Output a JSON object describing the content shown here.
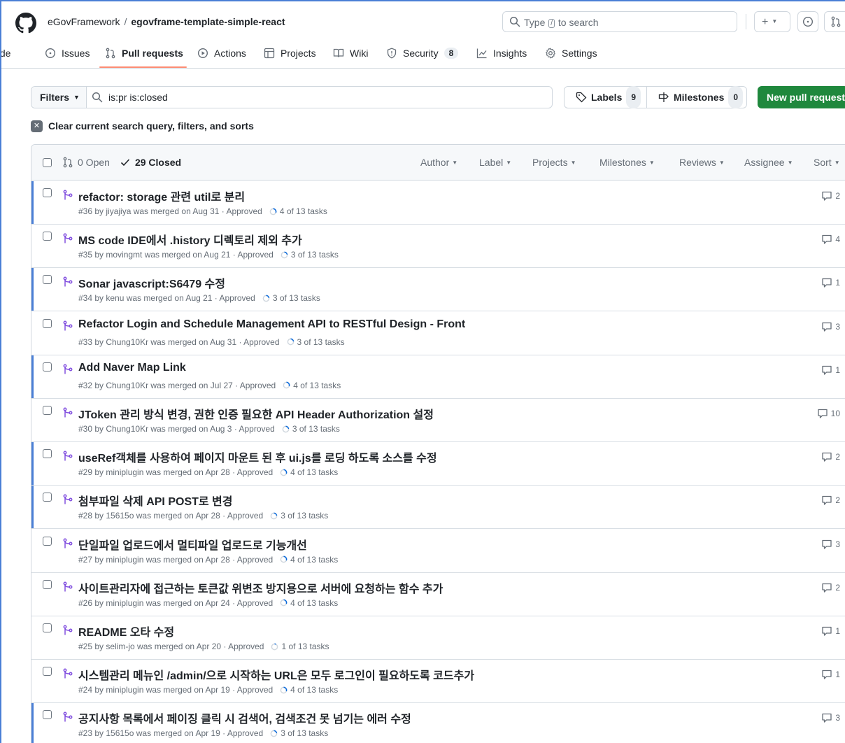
{
  "header": {
    "owner": "eGovFramework",
    "separator": "/",
    "repo": "egovframe-template-simple-react",
    "search_pre": "Type",
    "search_key": "/",
    "search_post": "to search",
    "command_glyph": ">_",
    "plus_glyph": "+"
  },
  "nav": {
    "items": [
      {
        "label": "Code",
        "icon": "code-icon"
      },
      {
        "label": "Issues",
        "icon": "issue-opened-icon"
      },
      {
        "label": "Pull requests",
        "icon": "git-pull-request-icon"
      },
      {
        "label": "Actions",
        "icon": "play-icon"
      },
      {
        "label": "Projects",
        "icon": "table-icon"
      },
      {
        "label": "Wiki",
        "icon": "book-icon"
      },
      {
        "label": "Security",
        "icon": "shield-icon",
        "count": "8"
      },
      {
        "label": "Insights",
        "icon": "graph-icon"
      },
      {
        "label": "Settings",
        "icon": "gear-icon"
      }
    ],
    "active": "Pull requests"
  },
  "filters": {
    "button_label": "Filters",
    "query": "is:pr is:closed",
    "labels_label": "Labels",
    "labels_count": "9",
    "milestones_label": "Milestones",
    "milestones_count": "0",
    "new_pr_label": "New pull request",
    "clear_label": "Clear current search query, filters, and sorts"
  },
  "list_header": {
    "open_label": "0 Open",
    "closed_label": "29 Closed",
    "filters": [
      "Author",
      "Label",
      "Projects",
      "Milestones",
      "Reviews",
      "Assignee",
      "Sort"
    ]
  },
  "pull_requests": [
    {
      "title": "refactor: storage 관련 util로 분리",
      "meta": "#36 by jiyajiya was merged on Aug 31 · Approved",
      "tasks": "4 of 13 tasks",
      "progress": 0.31,
      "comments": "2",
      "unread": true
    },
    {
      "title": "MS code IDE에서 .history 디렉토리 제외 추가",
      "meta": "#35 by movingmt was merged on Aug 21 · Approved",
      "tasks": "3 of 13 tasks",
      "progress": 0.23,
      "comments": "4",
      "unread": false
    },
    {
      "title": "Sonar javascript:S6479 수정",
      "meta": "#34 by kenu was merged on Aug 21 · Approved",
      "tasks": "3 of 13 tasks",
      "progress": 0.23,
      "comments": "1",
      "unread": true
    },
    {
      "title": "Refactor Login and Schedule Management API to RESTful Design - Front",
      "meta": "#33 by Chung10Kr was merged on Aug 31 · Approved",
      "tasks": "3 of 13 tasks",
      "progress": 0.23,
      "comments": "3",
      "unread": false
    },
    {
      "title": "Add Naver Map Link",
      "meta": "#32 by Chung10Kr was merged on Jul 27 · Approved",
      "tasks": "4 of 13 tasks",
      "progress": 0.31,
      "comments": "1",
      "unread": true
    },
    {
      "title": "JToken 관리 방식 변경, 권한 인증 필요한 API Header Authorization 설정",
      "meta": "#30 by Chung10Kr was merged on Aug 3 · Approved",
      "tasks": "3 of 13 tasks",
      "progress": 0.23,
      "comments": "10",
      "unread": false
    },
    {
      "title": "useRef객체를 사용하여 페이지 마운트 된 후 ui.js를 로딩 하도록 소스를 수정",
      "meta": "#29 by miniplugin was merged on Apr 28 · Approved",
      "tasks": "4 of 13 tasks",
      "progress": 0.31,
      "comments": "2",
      "unread": true
    },
    {
      "title": "첨부파일 삭제 API POST로 변경",
      "meta": "#28 by 15615o was merged on Apr 28 · Approved",
      "tasks": "3 of 13 tasks",
      "progress": 0.23,
      "comments": "2",
      "unread": true
    },
    {
      "title": "단일파일 업로드에서 멀티파일 업로드로 기능개선",
      "meta": "#27 by miniplugin was merged on Apr 28 · Approved",
      "tasks": "4 of 13 tasks",
      "progress": 0.31,
      "comments": "3",
      "unread": false
    },
    {
      "title": "사이트관리자에 접근하는 토큰값 위변조 방지용으로 서버에 요청하는 함수 추가",
      "meta": "#26 by miniplugin was merged on Apr 24 · Approved",
      "tasks": "4 of 13 tasks",
      "progress": 0.31,
      "comments": "2",
      "unread": false
    },
    {
      "title": "README 오타 수정",
      "meta": "#25 by selim-jo was merged on Apr 20 · Approved",
      "tasks": "1 of 13 tasks",
      "progress": 0.08,
      "comments": "1",
      "unread": false
    },
    {
      "title": "시스템관리 메뉴인 /admin/으로 시작하는 URL은 모두 로그인이 필요하도록 코드추가",
      "meta": "#24 by miniplugin was merged on Apr 19 · Approved",
      "tasks": "4 of 13 tasks",
      "progress": 0.31,
      "comments": "1",
      "unread": false
    },
    {
      "title": "공지사항 목록에서 페이징 클릭 시 검색어, 검색조건 못 넘기는 에러 수정",
      "meta": "#23 by 15615o was merged on Apr 19 · Approved",
      "tasks": "3 of 13 tasks",
      "progress": 0.23,
      "comments": "3",
      "unread": true
    }
  ],
  "colors": {
    "merged_purple": "#8250df",
    "primary_green": "#1f883d",
    "nav_underline": "#fd8c73",
    "unread_bar": "#4a7fd6"
  }
}
